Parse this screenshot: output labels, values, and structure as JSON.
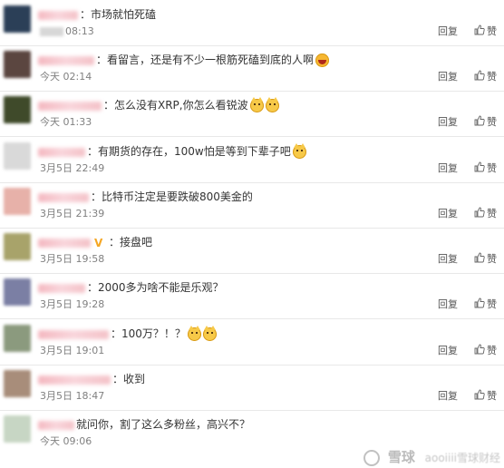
{
  "colors": {
    "background": "#ffffff",
    "text": "#333333",
    "time": "#808080",
    "name_blur": "#f4b8c0"
  },
  "actions": {
    "reply_label": "回复",
    "like_label": "赞",
    "like_icon": "thumbs-up-icon"
  },
  "comments": [
    {
      "text": "：市场就怕死磕",
      "time": "08:13",
      "time_prefix_blurred": true,
      "emojis": [],
      "avatar_color": "#2b3f57"
    },
    {
      "text": "：看留言，还是有不少一根筋死磕到底的人啊",
      "time": "今天 02:14",
      "emojis": [
        "laugh"
      ],
      "avatar_color": "#5b4640"
    },
    {
      "text": "：怎么没有XRP,你怎么看锐波",
      "time": "今天 01:33",
      "emojis": [
        "cat",
        "cat"
      ],
      "avatar_color": "#3f4a2a"
    },
    {
      "text": "：有期货的存在，100w怕是等到下辈子吧",
      "time": "3月5日 22:49",
      "emojis": [
        "cat"
      ],
      "avatar_color": "#d9d9d9"
    },
    {
      "text": "：比特币注定是要跌破800美金的",
      "time": "3月5日 21:39",
      "emojis": [],
      "avatar_color": "#e7b1a9"
    },
    {
      "text": "：接盘吧",
      "time": "3月5日 19:58",
      "vbadge": "V",
      "emojis": [],
      "avatar_color": "#a8a36a"
    },
    {
      "text": "：2000多为啥不能是乐观？",
      "time": "3月5日 19:28",
      "emojis": [],
      "avatar_color": "#7b7fa4"
    },
    {
      "text": "：100万？！？",
      "time": "3月5日 19:01",
      "emojis": [
        "cat",
        "cat"
      ],
      "avatar_color": "#8b9a7e"
    },
    {
      "text": "：收到",
      "time": "3月5日 18:47",
      "emojis": [],
      "avatar_color": "#a88d7a"
    },
    {
      "text": "就问你，割了这么多粉丝，高兴不？",
      "time": "今天 09:06",
      "emojis": [],
      "avatar_color": "#c7d6c4",
      "no_actions": true
    }
  ],
  "watermark": {
    "brand": "雪球",
    "sub": "aooiiii雪球财经"
  }
}
